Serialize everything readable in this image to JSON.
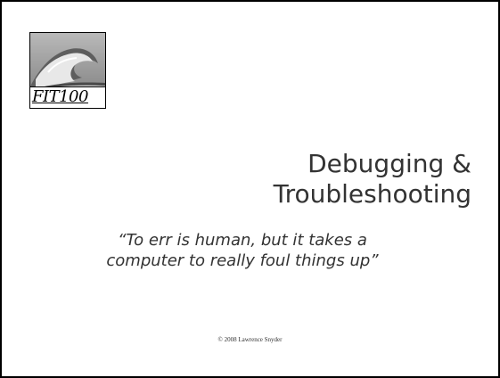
{
  "logo": {
    "label": "FIT100",
    "icon": "wave-photo-icon"
  },
  "title": {
    "line1": "Debugging &",
    "line2": "Troubleshooting"
  },
  "quote": {
    "line1": "“To err is human, but it takes a",
    "line2": "computer to really foul things up”"
  },
  "footer": {
    "copyright": "© 2008 Lawrence Snyder"
  }
}
